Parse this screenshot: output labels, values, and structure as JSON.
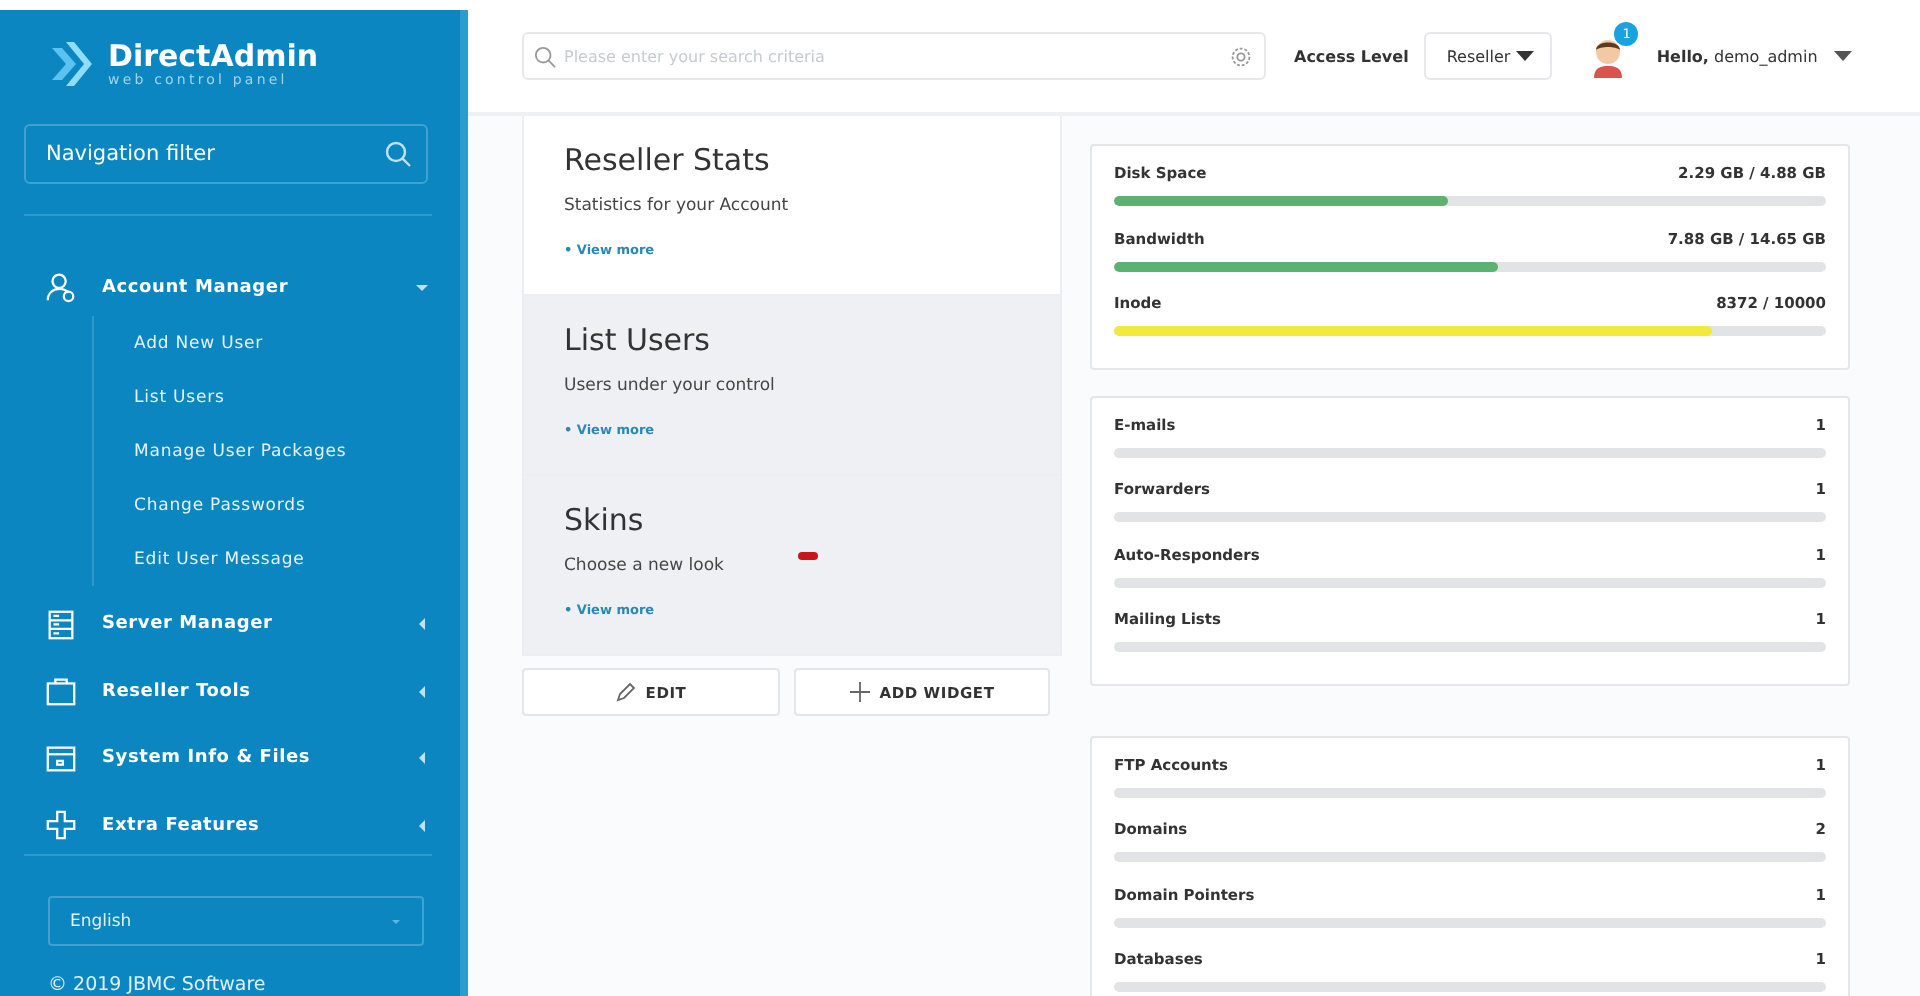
{
  "sidebar": {
    "logo": {
      "name": "DirectAdmin",
      "tagline": "web control panel"
    },
    "filter": {
      "placeholder": "Navigation filter"
    },
    "items": [
      {
        "label": "Account Manager",
        "expanded": true,
        "children": [
          {
            "label": "Add New User"
          },
          {
            "label": "List Users"
          },
          {
            "label": "Manage User Packages"
          },
          {
            "label": "Change Passwords"
          },
          {
            "label": "Edit User Message"
          }
        ]
      },
      {
        "label": "Server Manager",
        "expanded": false
      },
      {
        "label": "Reseller Tools",
        "expanded": false
      },
      {
        "label": "System Info & Files",
        "expanded": false
      },
      {
        "label": "Extra Features",
        "expanded": false
      }
    ],
    "language": "English",
    "copyright": "© 2019 JBMC Software"
  },
  "header": {
    "search": {
      "placeholder": "Please enter your search criteria"
    },
    "access_level_label": "Access Level",
    "access_level": "Reseller",
    "notification_count": "1",
    "greeting": "**Hello,** demo_admin"
  },
  "widgets": [
    {
      "title": "Reseller Stats",
      "subtitle": "Statistics for your Account",
      "link": "• View more",
      "shaded": false
    },
    {
      "title": "List Users",
      "subtitle": "Users under your control",
      "link": "• View more",
      "shaded": true
    },
    {
      "title": "Skins",
      "subtitle": "Choose a new look",
      "link": "• View more",
      "shaded": true
    }
  ],
  "buttons": [
    {
      "label": "EDIT"
    },
    {
      "label": "ADD WIDGET"
    }
  ],
  "stat_groups": [
    [
      {
        "name": "Disk Space",
        "reading": "2.29 GB / 4.88 GB",
        "level": 0.47,
        "color": "#5cb270"
      },
      {
        "name": "Bandwidth",
        "reading": "7.88 GB / 14.65 GB",
        "level": 0.54,
        "color": "#5cb270"
      },
      {
        "name": "Inode",
        "reading": "8372 / 10000",
        "level": 0.84,
        "color": "#f3e83c"
      }
    ],
    [
      {
        "name": "E-mails",
        "reading": "1",
        "level": 0
      },
      {
        "name": "Forwarders",
        "reading": "1",
        "level": 0
      },
      {
        "name": "Auto-Responders",
        "reading": "1",
        "level": 0
      },
      {
        "name": "Mailing Lists",
        "reading": "1",
        "level": 0
      }
    ],
    [
      {
        "name": "FTP Accounts",
        "reading": "1",
        "level": 0
      },
      {
        "name": "Domains",
        "reading": "2",
        "level": 0
      },
      {
        "name": "Domain Pointers",
        "reading": "1",
        "level": 0
      },
      {
        "name": "Databases",
        "reading": "1",
        "level": 0
      }
    ]
  ]
}
